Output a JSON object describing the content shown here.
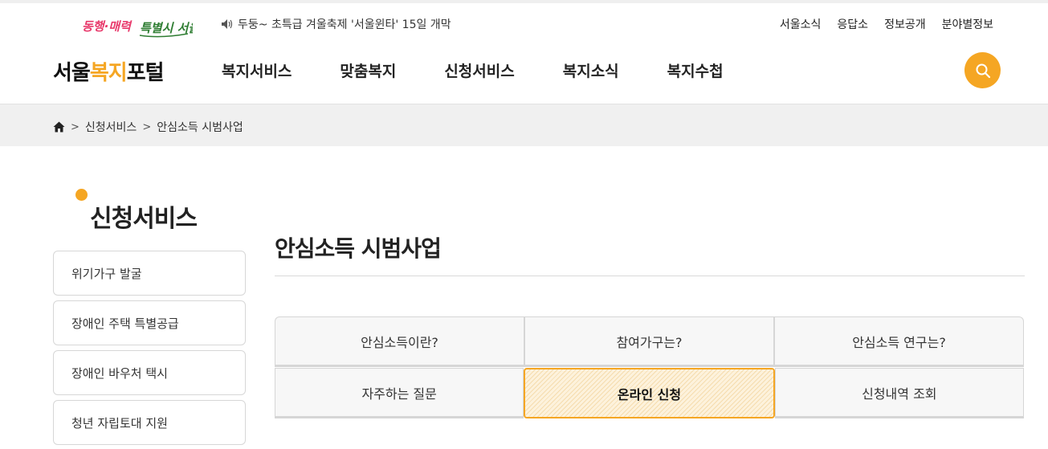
{
  "slogan": "동행·매력 특별시 서울",
  "notice": "두둥~ 초특급 겨울축제 '서울윈타' 15일 개막",
  "util_links": [
    "서울소식",
    "응답소",
    "정보공개",
    "분야별정보"
  ],
  "brand": {
    "part1": "서울",
    "part2": "복지",
    "part3": "포털"
  },
  "gnb": [
    "복지서비스",
    "맞춤복지",
    "신청서비스",
    "복지소식",
    "복지수첩"
  ],
  "breadcrumb": {
    "level1": "신청서비스",
    "level2": "안심소득 시범사업"
  },
  "side": {
    "title": "신청서비스",
    "items": [
      "위기가구 발굴",
      "장애인 주택 특별공급",
      "장애인 바우처 택시",
      "청년 자립토대 지원"
    ]
  },
  "content": {
    "title": "안심소득 시범사업",
    "tabs_row1": [
      "안심소득이란?",
      "참여가구는?",
      "안심소득 연구는?"
    ],
    "tabs_row2": [
      "자주하는 질문",
      "온라인 신청",
      "신청내역 조회"
    ],
    "active_tab": "온라인 신청"
  },
  "colors": {
    "accent": "#f5a623",
    "breadbar": "#f0f0f0"
  }
}
